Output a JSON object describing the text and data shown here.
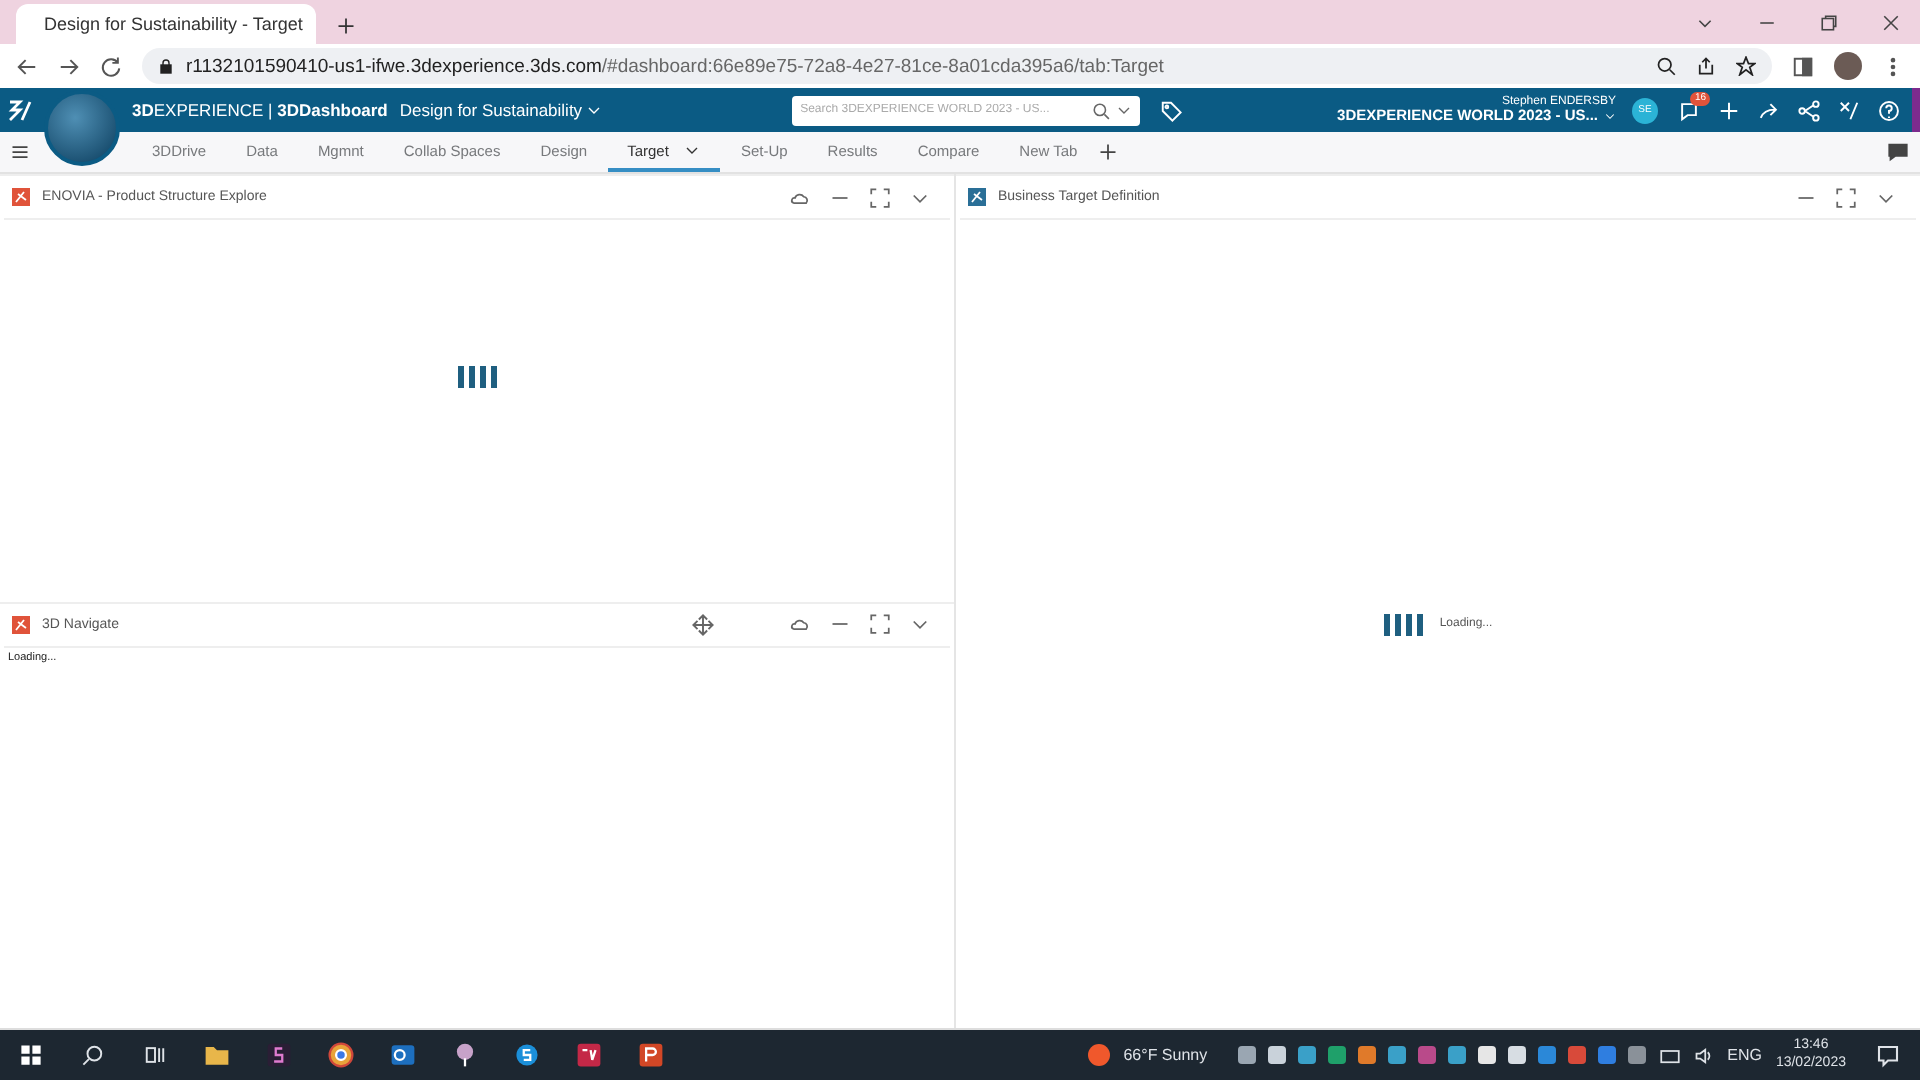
{
  "browser": {
    "tab_title": "Design for Sustainability - Target",
    "url_host": "r1132101590410-us1-ifwe.3dexperience.3ds.com",
    "url_path": "/#dashboard:66e89e75-72a8-4e27-81ce-8a01cda395a6/tab:Target"
  },
  "topbar": {
    "brand": "**3D**EXPERIENCE | **3DDashboard**",
    "dashboard": "Design for Sustainability",
    "search_placeholder": "Search 3DEXPERIENCE WORLD 2023 - US...",
    "user": "Stephen ENDERSBY",
    "platform": "3DEXPERIENCE WORLD 2023 - US...",
    "avatar": "SE",
    "notifications": "16"
  },
  "tabs": [
    {
      "label": "3DDrive",
      "selected": false
    },
    {
      "label": "Data",
      "selected": false
    },
    {
      "label": "Mgmnt",
      "selected": false
    },
    {
      "label": "Collab Spaces",
      "selected": false
    },
    {
      "label": "Design",
      "selected": false
    },
    {
      "label": "Target",
      "selected": true
    },
    {
      "label": "Set-Up",
      "selected": false
    },
    {
      "label": "Results",
      "selected": false
    },
    {
      "label": "Compare",
      "selected": false
    },
    {
      "label": "New Tab",
      "selected": false
    }
  ],
  "widgets": [
    {
      "title": "ENOVIA - Product Structure Explore",
      "color": "#e0533a",
      "move": false,
      "cloud": true,
      "body": {
        "kind": "spinner"
      }
    },
    {
      "title": "3D Navigate",
      "color": "#e0533a",
      "move": true,
      "cloud": true,
      "body": {
        "kind": "text",
        "text": "Loading..."
      }
    },
    {
      "title": "Business Target Definition",
      "color": "#2a6f97",
      "move": false,
      "cloud": false,
      "body": {
        "kind": "spinner_text",
        "text": "Loading..."
      }
    }
  ],
  "taskbar": {
    "weather": "66°F Sunny",
    "language": "ENG",
    "time": "13:46",
    "date": "13/02/2023"
  }
}
